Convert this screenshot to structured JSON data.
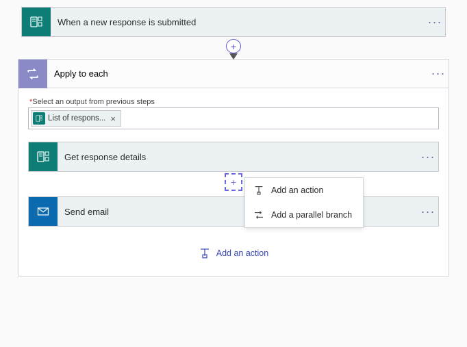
{
  "trigger": {
    "title": "When a new response is submitted",
    "more": "···"
  },
  "applyToEach": {
    "title": "Apply to each",
    "more": "···",
    "output_label": "Select an output from previous steps",
    "required_marker": "*",
    "token": {
      "label": "List of respons...",
      "remove": "×"
    },
    "steps": [
      {
        "title": "Get response details",
        "more": "···"
      },
      {
        "title": "Send email",
        "more": "···"
      }
    ],
    "add_button": "Add an action"
  },
  "popup": {
    "action": "Add an action",
    "parallel": "Add a parallel branch"
  },
  "icons": {
    "plus": "+"
  }
}
